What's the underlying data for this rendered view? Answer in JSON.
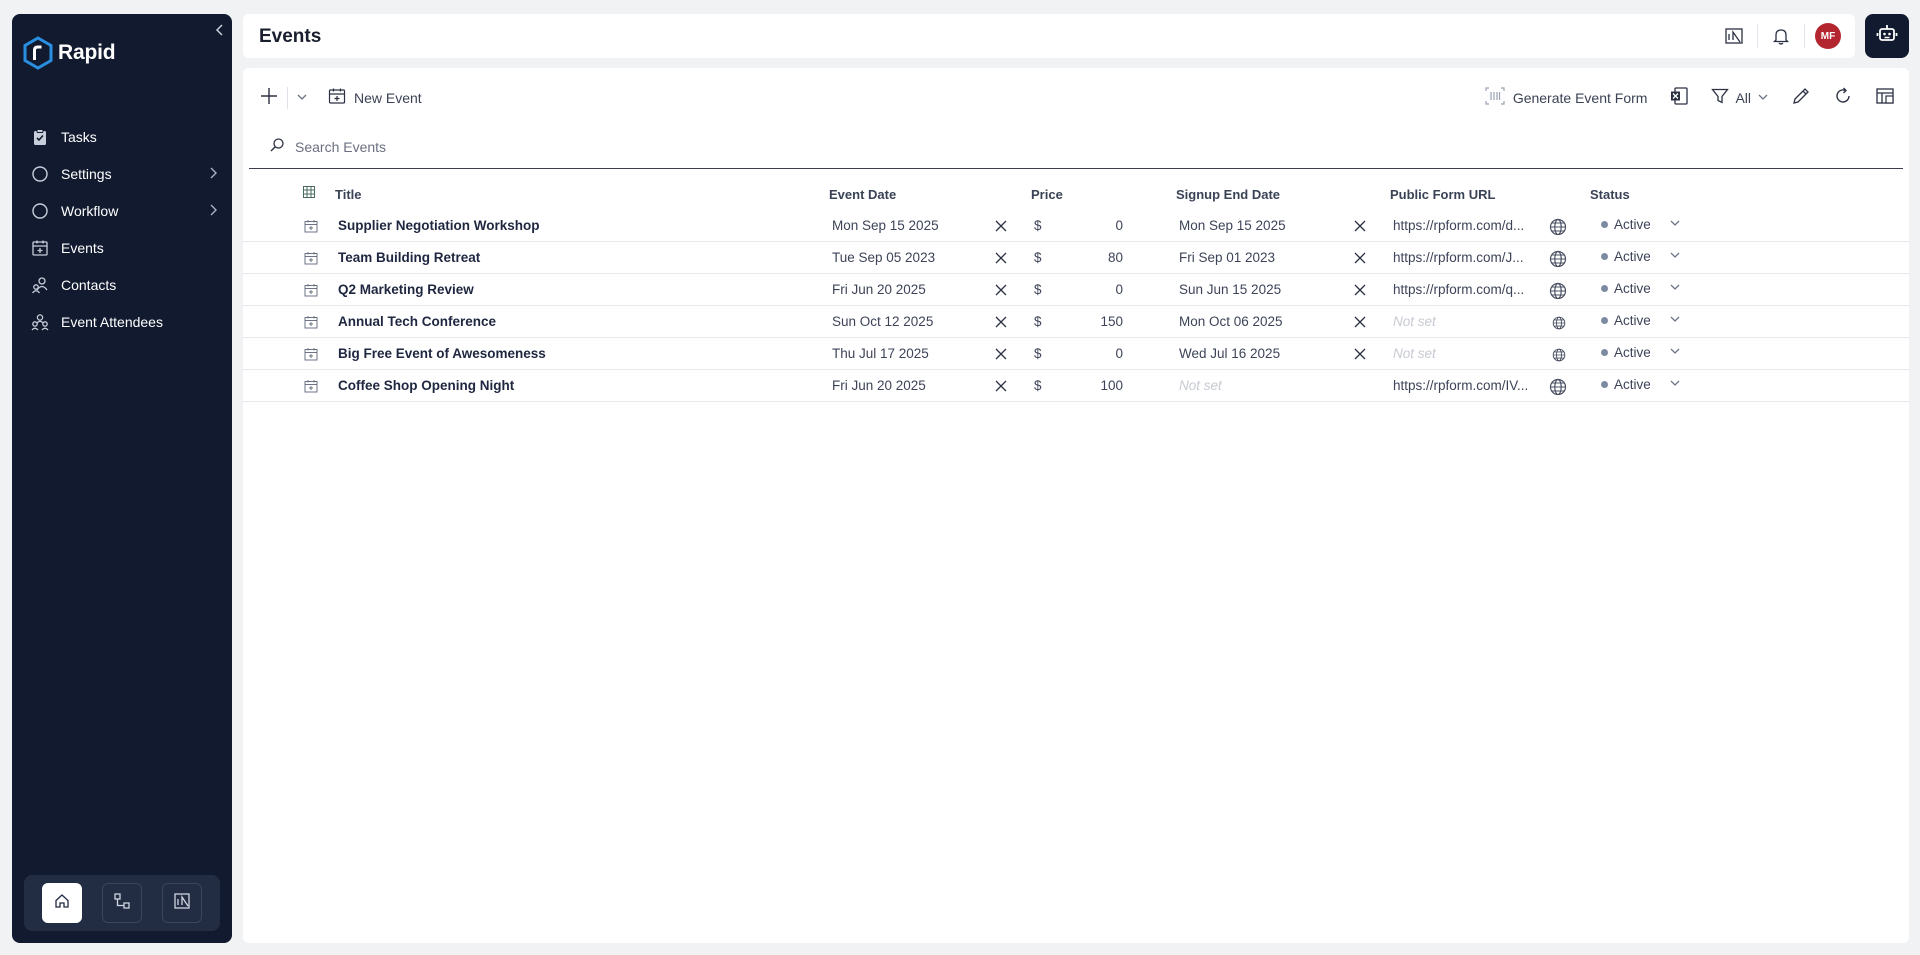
{
  "brand": {
    "name": "Rapid"
  },
  "sidebar": {
    "items": [
      {
        "label": "Tasks",
        "icon": "tasks-icon",
        "has_chevron": false
      },
      {
        "label": "Settings",
        "icon": "circle-icon",
        "has_chevron": true
      },
      {
        "label": "Workflow",
        "icon": "circle-icon",
        "has_chevron": true
      },
      {
        "label": "Events",
        "icon": "calendar-icon",
        "has_chevron": false
      },
      {
        "label": "Contacts",
        "icon": "contacts-icon",
        "has_chevron": false
      },
      {
        "label": "Event Attendees",
        "icon": "attendees-icon",
        "has_chevron": false
      }
    ]
  },
  "header": {
    "title": "Events",
    "avatar_initials": "MF"
  },
  "toolbar": {
    "new_event_label": "New Event",
    "generate_form_label": "Generate Event Form",
    "filter_label": "All"
  },
  "search": {
    "placeholder": "Search Events"
  },
  "table": {
    "columns": {
      "title": "Title",
      "event_date": "Event Date",
      "price": "Price",
      "signup_end": "Signup End Date",
      "public_url": "Public Form URL",
      "status": "Status"
    },
    "rows": [
      {
        "title": "Supplier Negotiation Workshop",
        "event_date": "Mon Sep 15 2025",
        "currency": "$",
        "price": "0",
        "signup_end": "Mon Sep 15 2025",
        "signup_clear": true,
        "url": "https://rpform.com/d...",
        "url_set": true,
        "status": "Active"
      },
      {
        "title": "Team Building Retreat",
        "event_date": "Tue Sep 05 2023",
        "currency": "$",
        "price": "80",
        "signup_end": "Fri Sep 01 2023",
        "signup_clear": true,
        "url": "https://rpform.com/J...",
        "url_set": true,
        "status": "Active"
      },
      {
        "title": "Q2 Marketing Review",
        "event_date": "Fri Jun 20 2025",
        "currency": "$",
        "price": "0",
        "signup_end": "Sun Jun 15 2025",
        "signup_clear": true,
        "url": "https://rpform.com/q...",
        "url_set": true,
        "status": "Active"
      },
      {
        "title": "Annual Tech Conference",
        "event_date": "Sun Oct 12 2025",
        "currency": "$",
        "price": "150",
        "signup_end": "Mon Oct 06 2025",
        "signup_clear": true,
        "url": "Not set",
        "url_set": false,
        "status": "Active"
      },
      {
        "title": "Big Free Event of Awesomeness",
        "event_date": "Thu Jul 17 2025",
        "currency": "$",
        "price": "0",
        "signup_end": "Wed Jul 16 2025",
        "signup_clear": true,
        "url": "Not set",
        "url_set": false,
        "status": "Active"
      },
      {
        "title": "Coffee Shop Opening Night",
        "event_date": "Fri Jun 20 2025",
        "currency": "$",
        "price": "100",
        "signup_end": "Not set",
        "signup_clear": false,
        "url": "https://rpform.com/IV...",
        "url_set": true,
        "status": "Active"
      }
    ]
  },
  "colors": {
    "sidebar_bg": "#111a2e",
    "avatar_bg": "#b3262f",
    "status_dot": "#7e8aa2"
  }
}
